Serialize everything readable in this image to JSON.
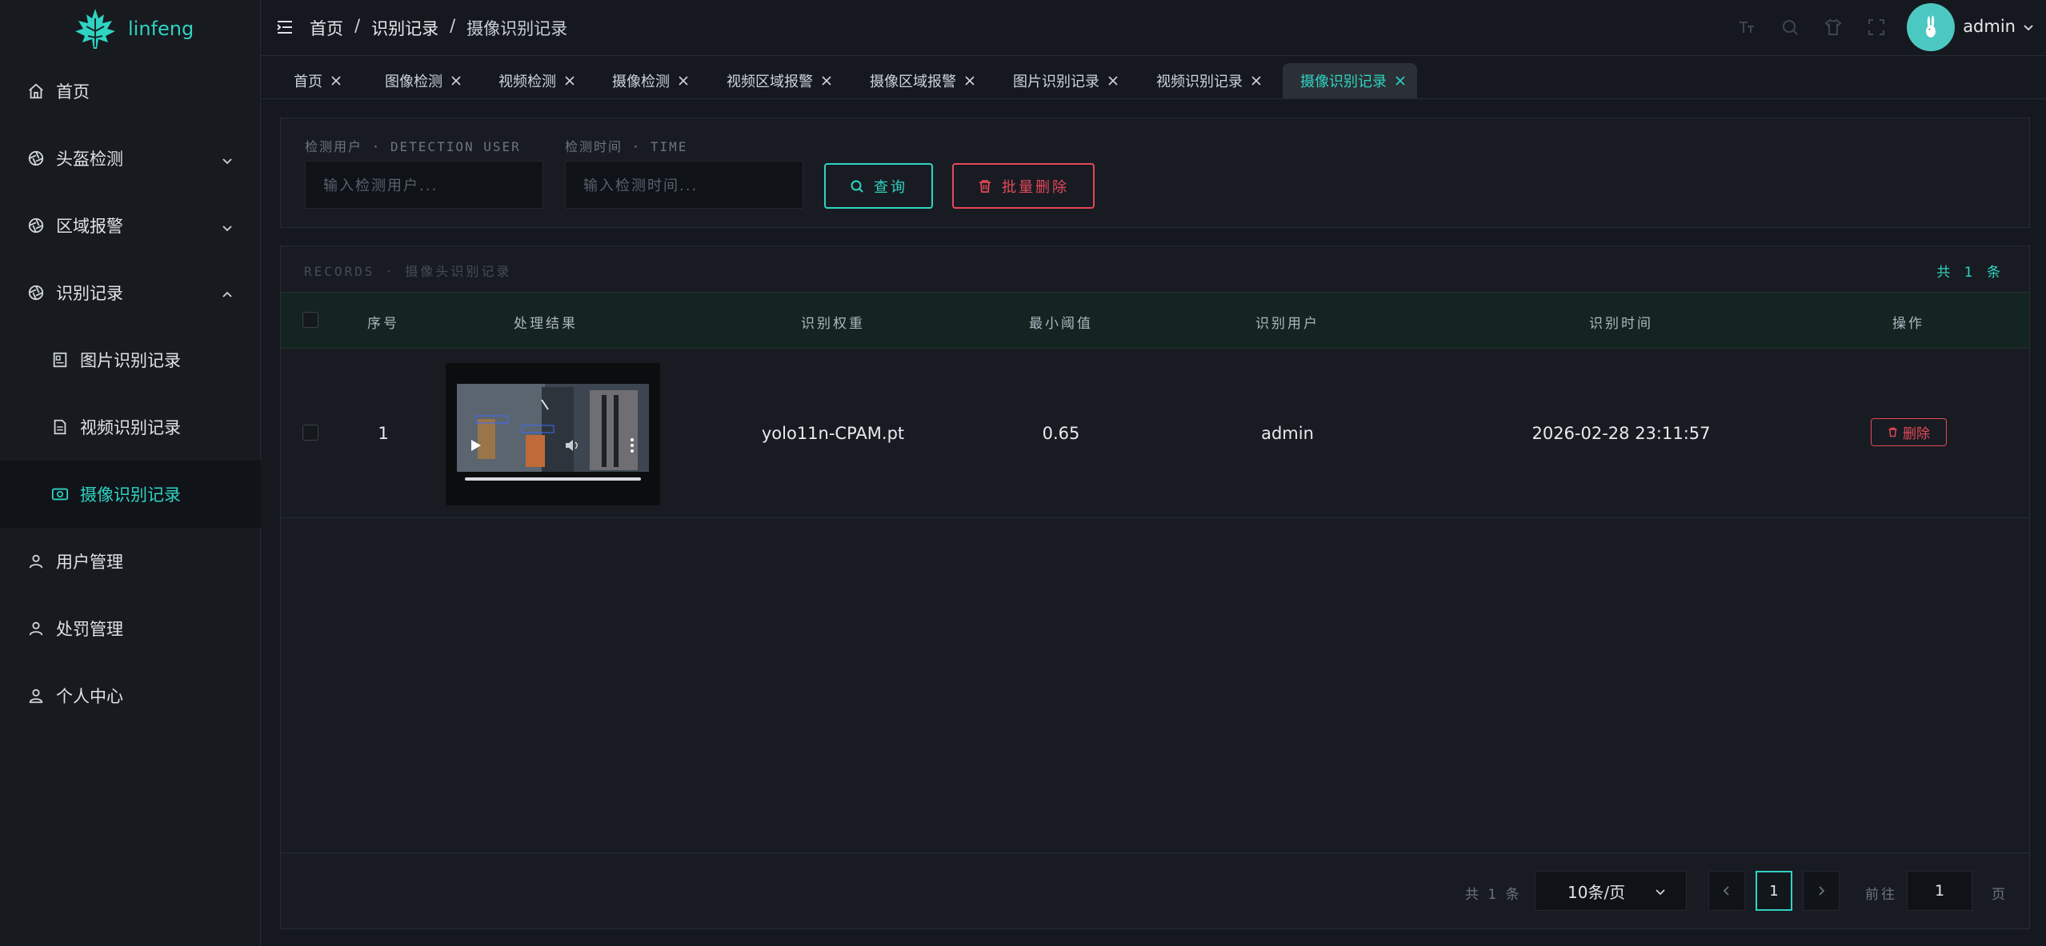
{
  "app": {
    "name": "linfeng"
  },
  "sidebar": {
    "items": [
      {
        "label": "首页"
      },
      {
        "label": "头盔检测"
      },
      {
        "label": "区域报警"
      },
      {
        "label": "识别记录"
      },
      {
        "label": "图片识别记录"
      },
      {
        "label": "视频识别记录"
      },
      {
        "label": "摄像识别记录"
      },
      {
        "label": "用户管理"
      },
      {
        "label": "处罚管理"
      },
      {
        "label": "个人中心"
      }
    ],
    "active": "摄像识别记录"
  },
  "header": {
    "breadcrumb": [
      "首页",
      "识别记录",
      "摄像识别记录"
    ],
    "separator": "/",
    "user": "admin"
  },
  "tabs": [
    {
      "label": "首页"
    },
    {
      "label": "图像检测"
    },
    {
      "label": "视频检测"
    },
    {
      "label": "摄像检测"
    },
    {
      "label": "视频区域报警"
    },
    {
      "label": "摄像区域报警"
    },
    {
      "label": "图片识别记录"
    },
    {
      "label": "视频识别记录"
    },
    {
      "label": "摄像识别记录"
    }
  ],
  "filter": {
    "user_label": "检测用户 · DETECTION USER",
    "time_label": "检测时间 · TIME",
    "user_placeholder": "输入检测用户...",
    "time_placeholder": "输入检测时间...",
    "query_label": "查询",
    "batch_delete_label": "批量删除"
  },
  "records": {
    "title": "RECORDS · 摄像头识别记录",
    "count_label": "共 1 条",
    "columns": [
      "序号",
      "处理结果",
      "识别权重",
      "最小阈值",
      "识别用户",
      "识别时间",
      "操作"
    ],
    "rows": [
      {
        "index": "1",
        "weight": "yolo11n-CPAM.pt",
        "threshold": "0.65",
        "user": "admin",
        "time": "2026-02-28 23:11:57",
        "action": "删除"
      }
    ]
  },
  "pagination": {
    "total": "共 1 条",
    "page_size": "10条/页",
    "current": "1",
    "goto_label": "前往",
    "goto_value": "1",
    "page_suffix": "页"
  },
  "colors": {
    "accent": "#2fd3c2",
    "danger": "#e5485a",
    "background": "#15191f"
  }
}
